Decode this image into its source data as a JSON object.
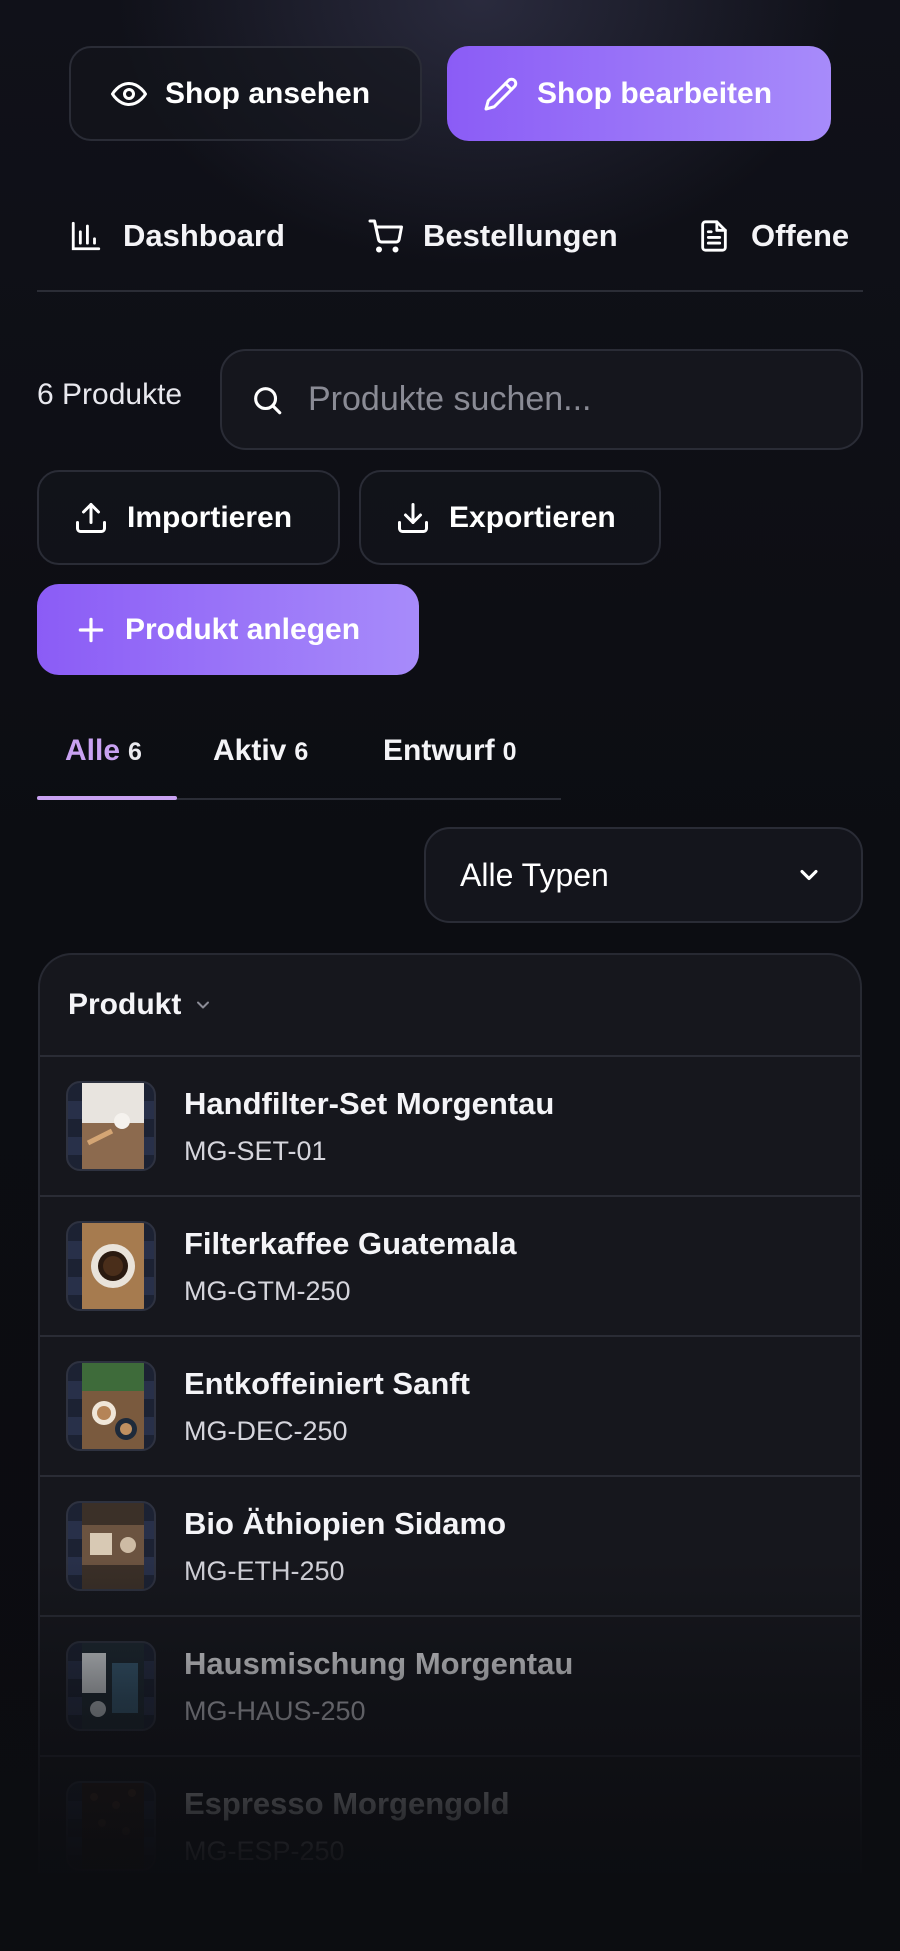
{
  "header": {
    "view_shop_label": "Shop ansehen",
    "edit_shop_label": "Shop bearbeiten"
  },
  "nav": {
    "items": [
      {
        "label": "Dashboard",
        "icon": "bar-chart-icon"
      },
      {
        "label": "Bestellungen",
        "icon": "cart-icon"
      },
      {
        "label": "Offene",
        "icon": "document-icon"
      }
    ]
  },
  "products": {
    "count_label": "6 Produkte",
    "search_placeholder": "Produkte suchen...",
    "import_label": "Importieren",
    "export_label": "Exportieren",
    "create_label": "Produkt anlegen",
    "tabs": [
      {
        "label": "Alle",
        "count": "6"
      },
      {
        "label": "Aktiv",
        "count": "6"
      },
      {
        "label": "Entwurf",
        "count": "0"
      }
    ],
    "type_filter": "Alle Typen",
    "table_header": "Produkt",
    "rows": [
      {
        "name": "Handfilter-Set Morgentau",
        "sku": "MG-SET-01"
      },
      {
        "name": "Filterkaffee Guatemala",
        "sku": "MG-GTM-250"
      },
      {
        "name": "Entkoffeiniert Sanft",
        "sku": "MG-DEC-250"
      },
      {
        "name": "Bio Äthiopien Sidamo",
        "sku": "MG-ETH-250"
      },
      {
        "name": "Hausmischung Morgentau",
        "sku": "MG-HAUS-250"
      },
      {
        "name": "Espresso Morgengold",
        "sku": "MG-ESP-250"
      }
    ]
  },
  "colors": {
    "accent": "#8b5cf6",
    "accent_light": "#a78bfa",
    "active_tab": "#c9a2f2",
    "background": "#0c0d12"
  }
}
